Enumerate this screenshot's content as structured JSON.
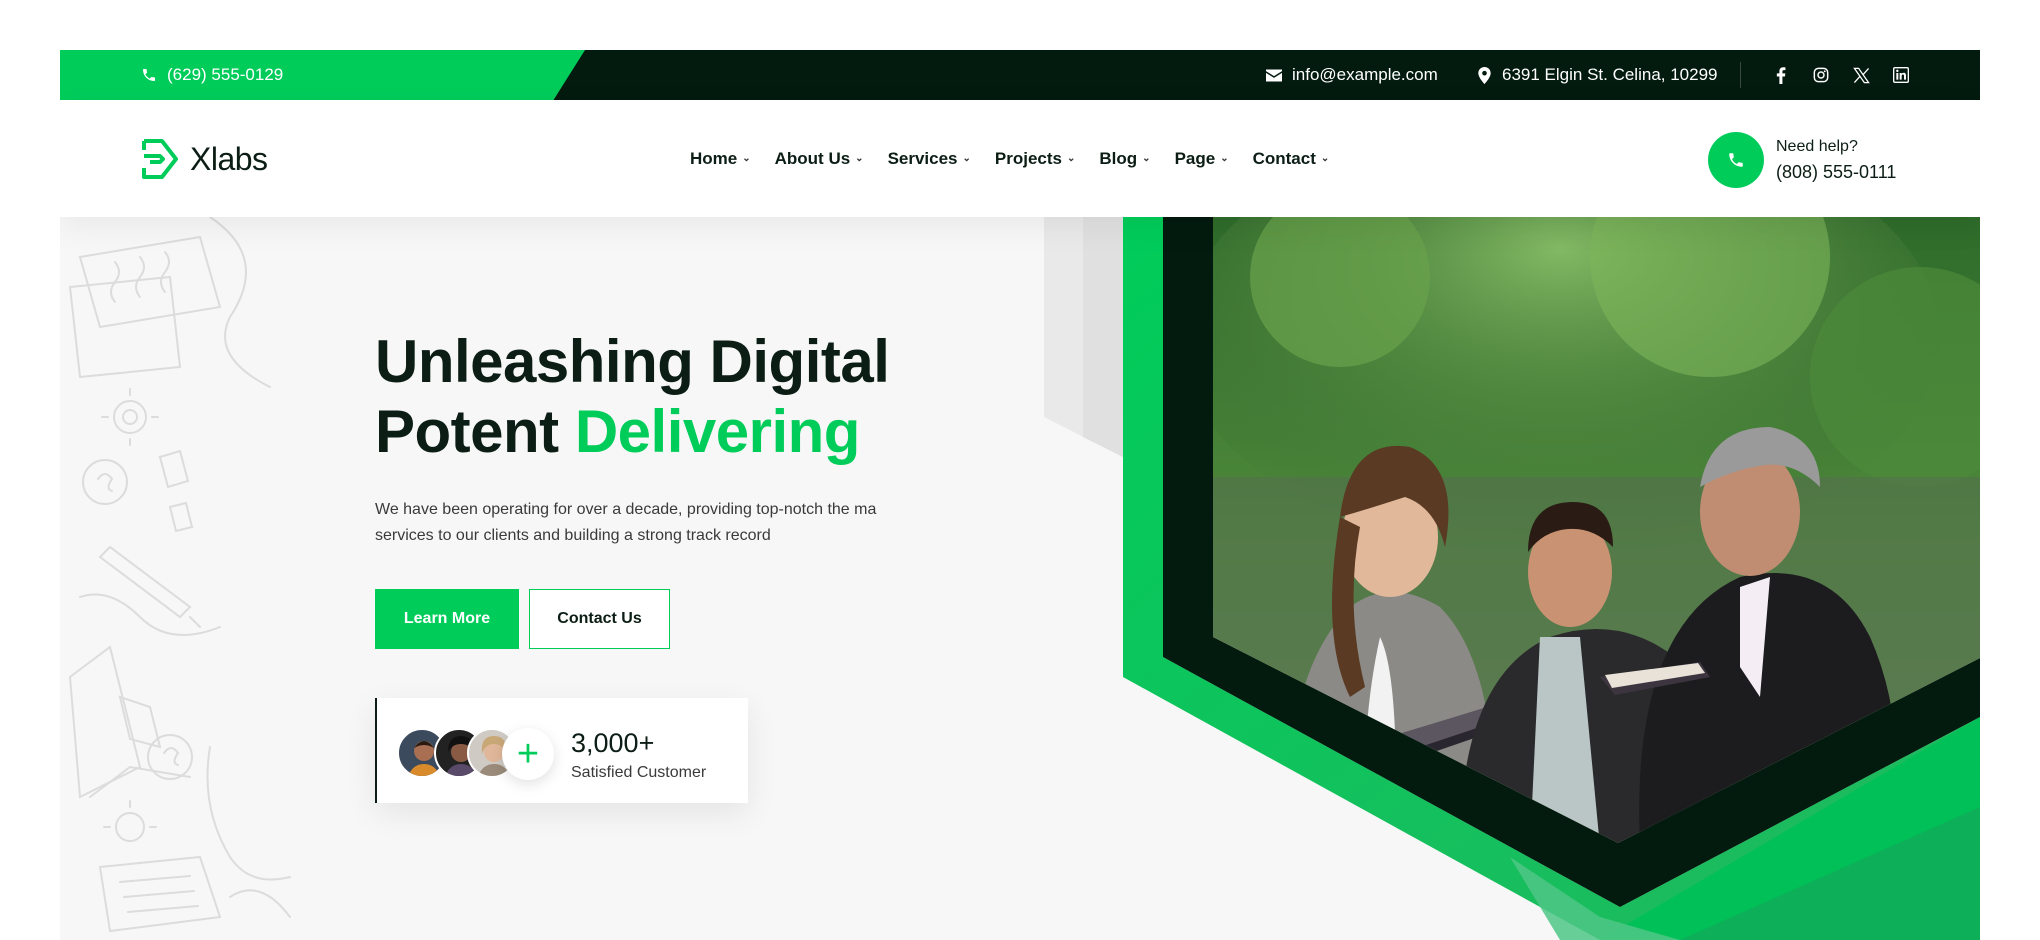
{
  "topbar": {
    "phone": "(629) 555-0129",
    "email": "info@example.com",
    "address": "6391 Elgin St. Celina, 10299",
    "social": [
      "facebook-icon",
      "instagram-icon",
      "x-icon",
      "linkedin-icon"
    ]
  },
  "header": {
    "logo_text": "Xlabs",
    "nav": [
      {
        "label": "Home"
      },
      {
        "label": "About Us"
      },
      {
        "label": "Services"
      },
      {
        "label": "Projects"
      },
      {
        "label": "Blog"
      },
      {
        "label": "Page"
      },
      {
        "label": "Contact"
      }
    ],
    "help_label": "Need help?",
    "help_phone": "(808) 555-0111"
  },
  "hero": {
    "title_line1": "Unleashing Digital",
    "title_line2_plain": "Potent",
    "title_line2_accent": "Delivering",
    "description": "We have been operating for over a decade, providing top-notch the ma services to our clients and building a strong track record",
    "btn_primary": "Learn More",
    "btn_secondary": "Contact Us",
    "customers_count": "3,000+",
    "customers_label": "Satisfied Customer"
  },
  "colors": {
    "accent": "#00cc5a",
    "dark": "#031a0e",
    "text": "#0b1d14"
  }
}
